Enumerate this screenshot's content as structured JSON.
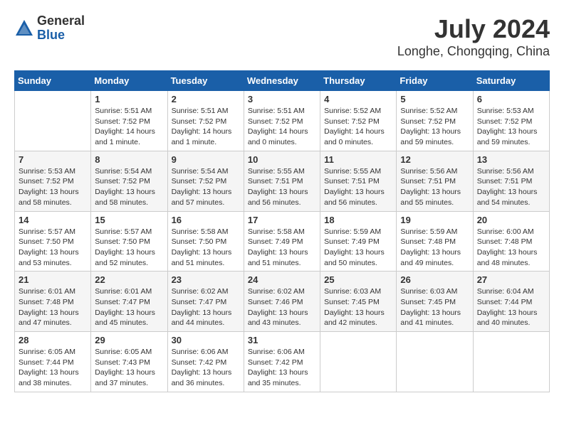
{
  "header": {
    "logo_general": "General",
    "logo_blue": "Blue",
    "month_year": "July 2024",
    "location": "Longhe, Chongqing, China"
  },
  "weekdays": [
    "Sunday",
    "Monday",
    "Tuesday",
    "Wednesday",
    "Thursday",
    "Friday",
    "Saturday"
  ],
  "weeks": [
    [
      {
        "day": "",
        "info": ""
      },
      {
        "day": "1",
        "info": "Sunrise: 5:51 AM\nSunset: 7:52 PM\nDaylight: 14 hours\nand 1 minute."
      },
      {
        "day": "2",
        "info": "Sunrise: 5:51 AM\nSunset: 7:52 PM\nDaylight: 14 hours\nand 1 minute."
      },
      {
        "day": "3",
        "info": "Sunrise: 5:51 AM\nSunset: 7:52 PM\nDaylight: 14 hours\nand 0 minutes."
      },
      {
        "day": "4",
        "info": "Sunrise: 5:52 AM\nSunset: 7:52 PM\nDaylight: 14 hours\nand 0 minutes."
      },
      {
        "day": "5",
        "info": "Sunrise: 5:52 AM\nSunset: 7:52 PM\nDaylight: 13 hours\nand 59 minutes."
      },
      {
        "day": "6",
        "info": "Sunrise: 5:53 AM\nSunset: 7:52 PM\nDaylight: 13 hours\nand 59 minutes."
      }
    ],
    [
      {
        "day": "7",
        "info": "Sunrise: 5:53 AM\nSunset: 7:52 PM\nDaylight: 13 hours\nand 58 minutes."
      },
      {
        "day": "8",
        "info": "Sunrise: 5:54 AM\nSunset: 7:52 PM\nDaylight: 13 hours\nand 58 minutes."
      },
      {
        "day": "9",
        "info": "Sunrise: 5:54 AM\nSunset: 7:52 PM\nDaylight: 13 hours\nand 57 minutes."
      },
      {
        "day": "10",
        "info": "Sunrise: 5:55 AM\nSunset: 7:51 PM\nDaylight: 13 hours\nand 56 minutes."
      },
      {
        "day": "11",
        "info": "Sunrise: 5:55 AM\nSunset: 7:51 PM\nDaylight: 13 hours\nand 56 minutes."
      },
      {
        "day": "12",
        "info": "Sunrise: 5:56 AM\nSunset: 7:51 PM\nDaylight: 13 hours\nand 55 minutes."
      },
      {
        "day": "13",
        "info": "Sunrise: 5:56 AM\nSunset: 7:51 PM\nDaylight: 13 hours\nand 54 minutes."
      }
    ],
    [
      {
        "day": "14",
        "info": "Sunrise: 5:57 AM\nSunset: 7:50 PM\nDaylight: 13 hours\nand 53 minutes."
      },
      {
        "day": "15",
        "info": "Sunrise: 5:57 AM\nSunset: 7:50 PM\nDaylight: 13 hours\nand 52 minutes."
      },
      {
        "day": "16",
        "info": "Sunrise: 5:58 AM\nSunset: 7:50 PM\nDaylight: 13 hours\nand 51 minutes."
      },
      {
        "day": "17",
        "info": "Sunrise: 5:58 AM\nSunset: 7:49 PM\nDaylight: 13 hours\nand 51 minutes."
      },
      {
        "day": "18",
        "info": "Sunrise: 5:59 AM\nSunset: 7:49 PM\nDaylight: 13 hours\nand 50 minutes."
      },
      {
        "day": "19",
        "info": "Sunrise: 5:59 AM\nSunset: 7:48 PM\nDaylight: 13 hours\nand 49 minutes."
      },
      {
        "day": "20",
        "info": "Sunrise: 6:00 AM\nSunset: 7:48 PM\nDaylight: 13 hours\nand 48 minutes."
      }
    ],
    [
      {
        "day": "21",
        "info": "Sunrise: 6:01 AM\nSunset: 7:48 PM\nDaylight: 13 hours\nand 47 minutes."
      },
      {
        "day": "22",
        "info": "Sunrise: 6:01 AM\nSunset: 7:47 PM\nDaylight: 13 hours\nand 45 minutes."
      },
      {
        "day": "23",
        "info": "Sunrise: 6:02 AM\nSunset: 7:47 PM\nDaylight: 13 hours\nand 44 minutes."
      },
      {
        "day": "24",
        "info": "Sunrise: 6:02 AM\nSunset: 7:46 PM\nDaylight: 13 hours\nand 43 minutes."
      },
      {
        "day": "25",
        "info": "Sunrise: 6:03 AM\nSunset: 7:45 PM\nDaylight: 13 hours\nand 42 minutes."
      },
      {
        "day": "26",
        "info": "Sunrise: 6:03 AM\nSunset: 7:45 PM\nDaylight: 13 hours\nand 41 minutes."
      },
      {
        "day": "27",
        "info": "Sunrise: 6:04 AM\nSunset: 7:44 PM\nDaylight: 13 hours\nand 40 minutes."
      }
    ],
    [
      {
        "day": "28",
        "info": "Sunrise: 6:05 AM\nSunset: 7:44 PM\nDaylight: 13 hours\nand 38 minutes."
      },
      {
        "day": "29",
        "info": "Sunrise: 6:05 AM\nSunset: 7:43 PM\nDaylight: 13 hours\nand 37 minutes."
      },
      {
        "day": "30",
        "info": "Sunrise: 6:06 AM\nSunset: 7:42 PM\nDaylight: 13 hours\nand 36 minutes."
      },
      {
        "day": "31",
        "info": "Sunrise: 6:06 AM\nSunset: 7:42 PM\nDaylight: 13 hours\nand 35 minutes."
      },
      {
        "day": "",
        "info": ""
      },
      {
        "day": "",
        "info": ""
      },
      {
        "day": "",
        "info": ""
      }
    ]
  ]
}
